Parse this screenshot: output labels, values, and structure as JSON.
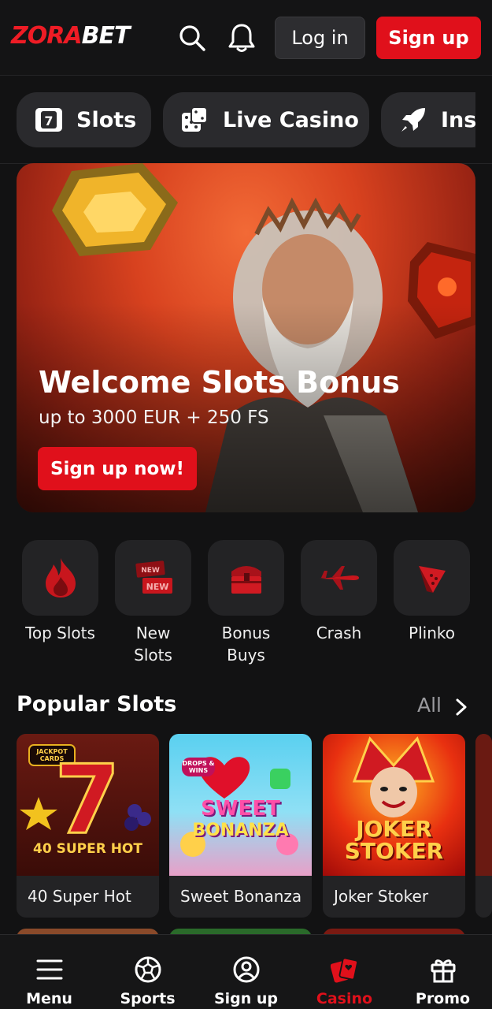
{
  "header": {
    "logo_part1": "ZORA",
    "logo_part2": "BET",
    "login_label": "Log in",
    "signup_label": "Sign up",
    "search_icon": "search-icon",
    "bell_icon": "bell-icon"
  },
  "categories": [
    {
      "label": "Slots",
      "icon": "slot-seven-icon"
    },
    {
      "label": "Live Casino",
      "icon": "dice-icon"
    },
    {
      "label": "Instant",
      "icon": "rocket-icon"
    }
  ],
  "hero": {
    "title": "Welcome Slots Bonus",
    "subtitle": "up to 3000 EUR + 250 FS",
    "cta": "Sign up now!"
  },
  "quick": [
    {
      "label": "Top Slots",
      "icon": "flame-icon"
    },
    {
      "label": "New Slots",
      "icon": "new-badge-icon"
    },
    {
      "label": "Bonus Buys",
      "icon": "treasure-chest-icon"
    },
    {
      "label": "Crash",
      "icon": "plane-icon"
    },
    {
      "label": "Plinko",
      "icon": "pyramid-icon"
    }
  ],
  "popular": {
    "title": "Popular Slots",
    "all_label": "All",
    "games": [
      {
        "name": "40 Super Hot",
        "art_text": "40 SUPER HOT",
        "badge": "JACKPOT CARDS"
      },
      {
        "name": "Sweet Bonanza",
        "art_text_1": "SWEET",
        "art_text_2": "BONANZA",
        "badge": "DROPS & WINS"
      },
      {
        "name": "Joker Stoker",
        "art_text_1": "JOKER",
        "art_text_2": "STOKER"
      }
    ]
  },
  "nav": [
    {
      "label": "Menu",
      "icon": "hamburger-icon"
    },
    {
      "label": "Sports",
      "icon": "soccer-ball-icon"
    },
    {
      "label": "Sign up",
      "icon": "user-icon"
    },
    {
      "label": "Casino",
      "icon": "cards-icon",
      "active": true
    },
    {
      "label": "Promo",
      "icon": "gift-icon"
    }
  ],
  "colors": {
    "accent": "#e0101b",
    "background": "#121213",
    "surface": "#232325"
  }
}
